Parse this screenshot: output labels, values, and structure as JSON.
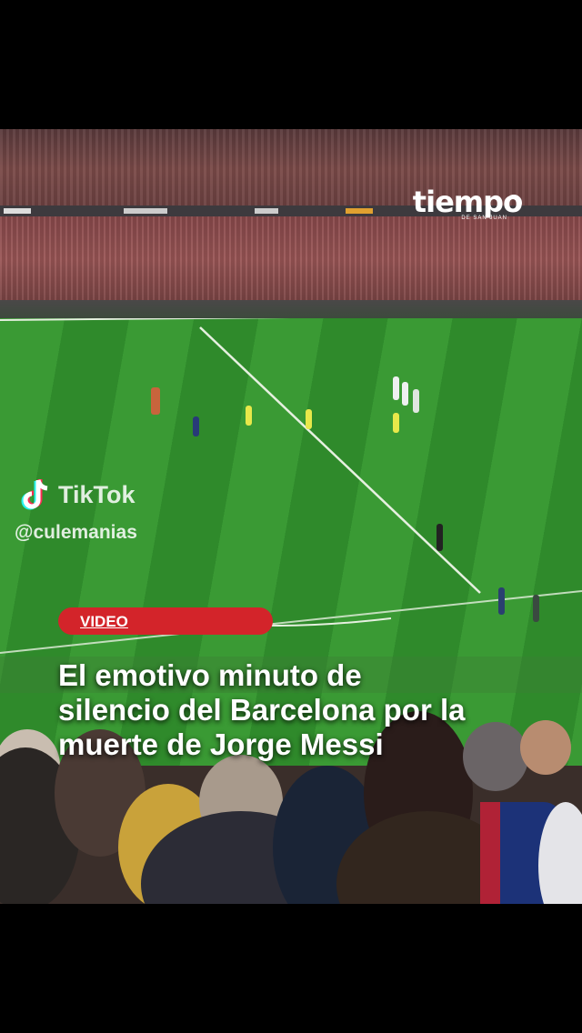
{
  "overlay": {
    "brand_name": "tiempo",
    "brand_sub": "DE SAN JUAN",
    "tiktok_name": "TikTok",
    "tiktok_handle": "@culemanias",
    "tag_label": "VIDEO",
    "headline_lines": [
      "El emotivo minuto de",
      "silencio del Barcelona por la",
      "muerte de Jorge Messi"
    ]
  },
  "colors": {
    "tag_red": "#d3242a",
    "pitch_green": "#3a9a34",
    "background": "#000000"
  },
  "icons": [
    "tiktok-logo-icon",
    "globe-icon"
  ]
}
